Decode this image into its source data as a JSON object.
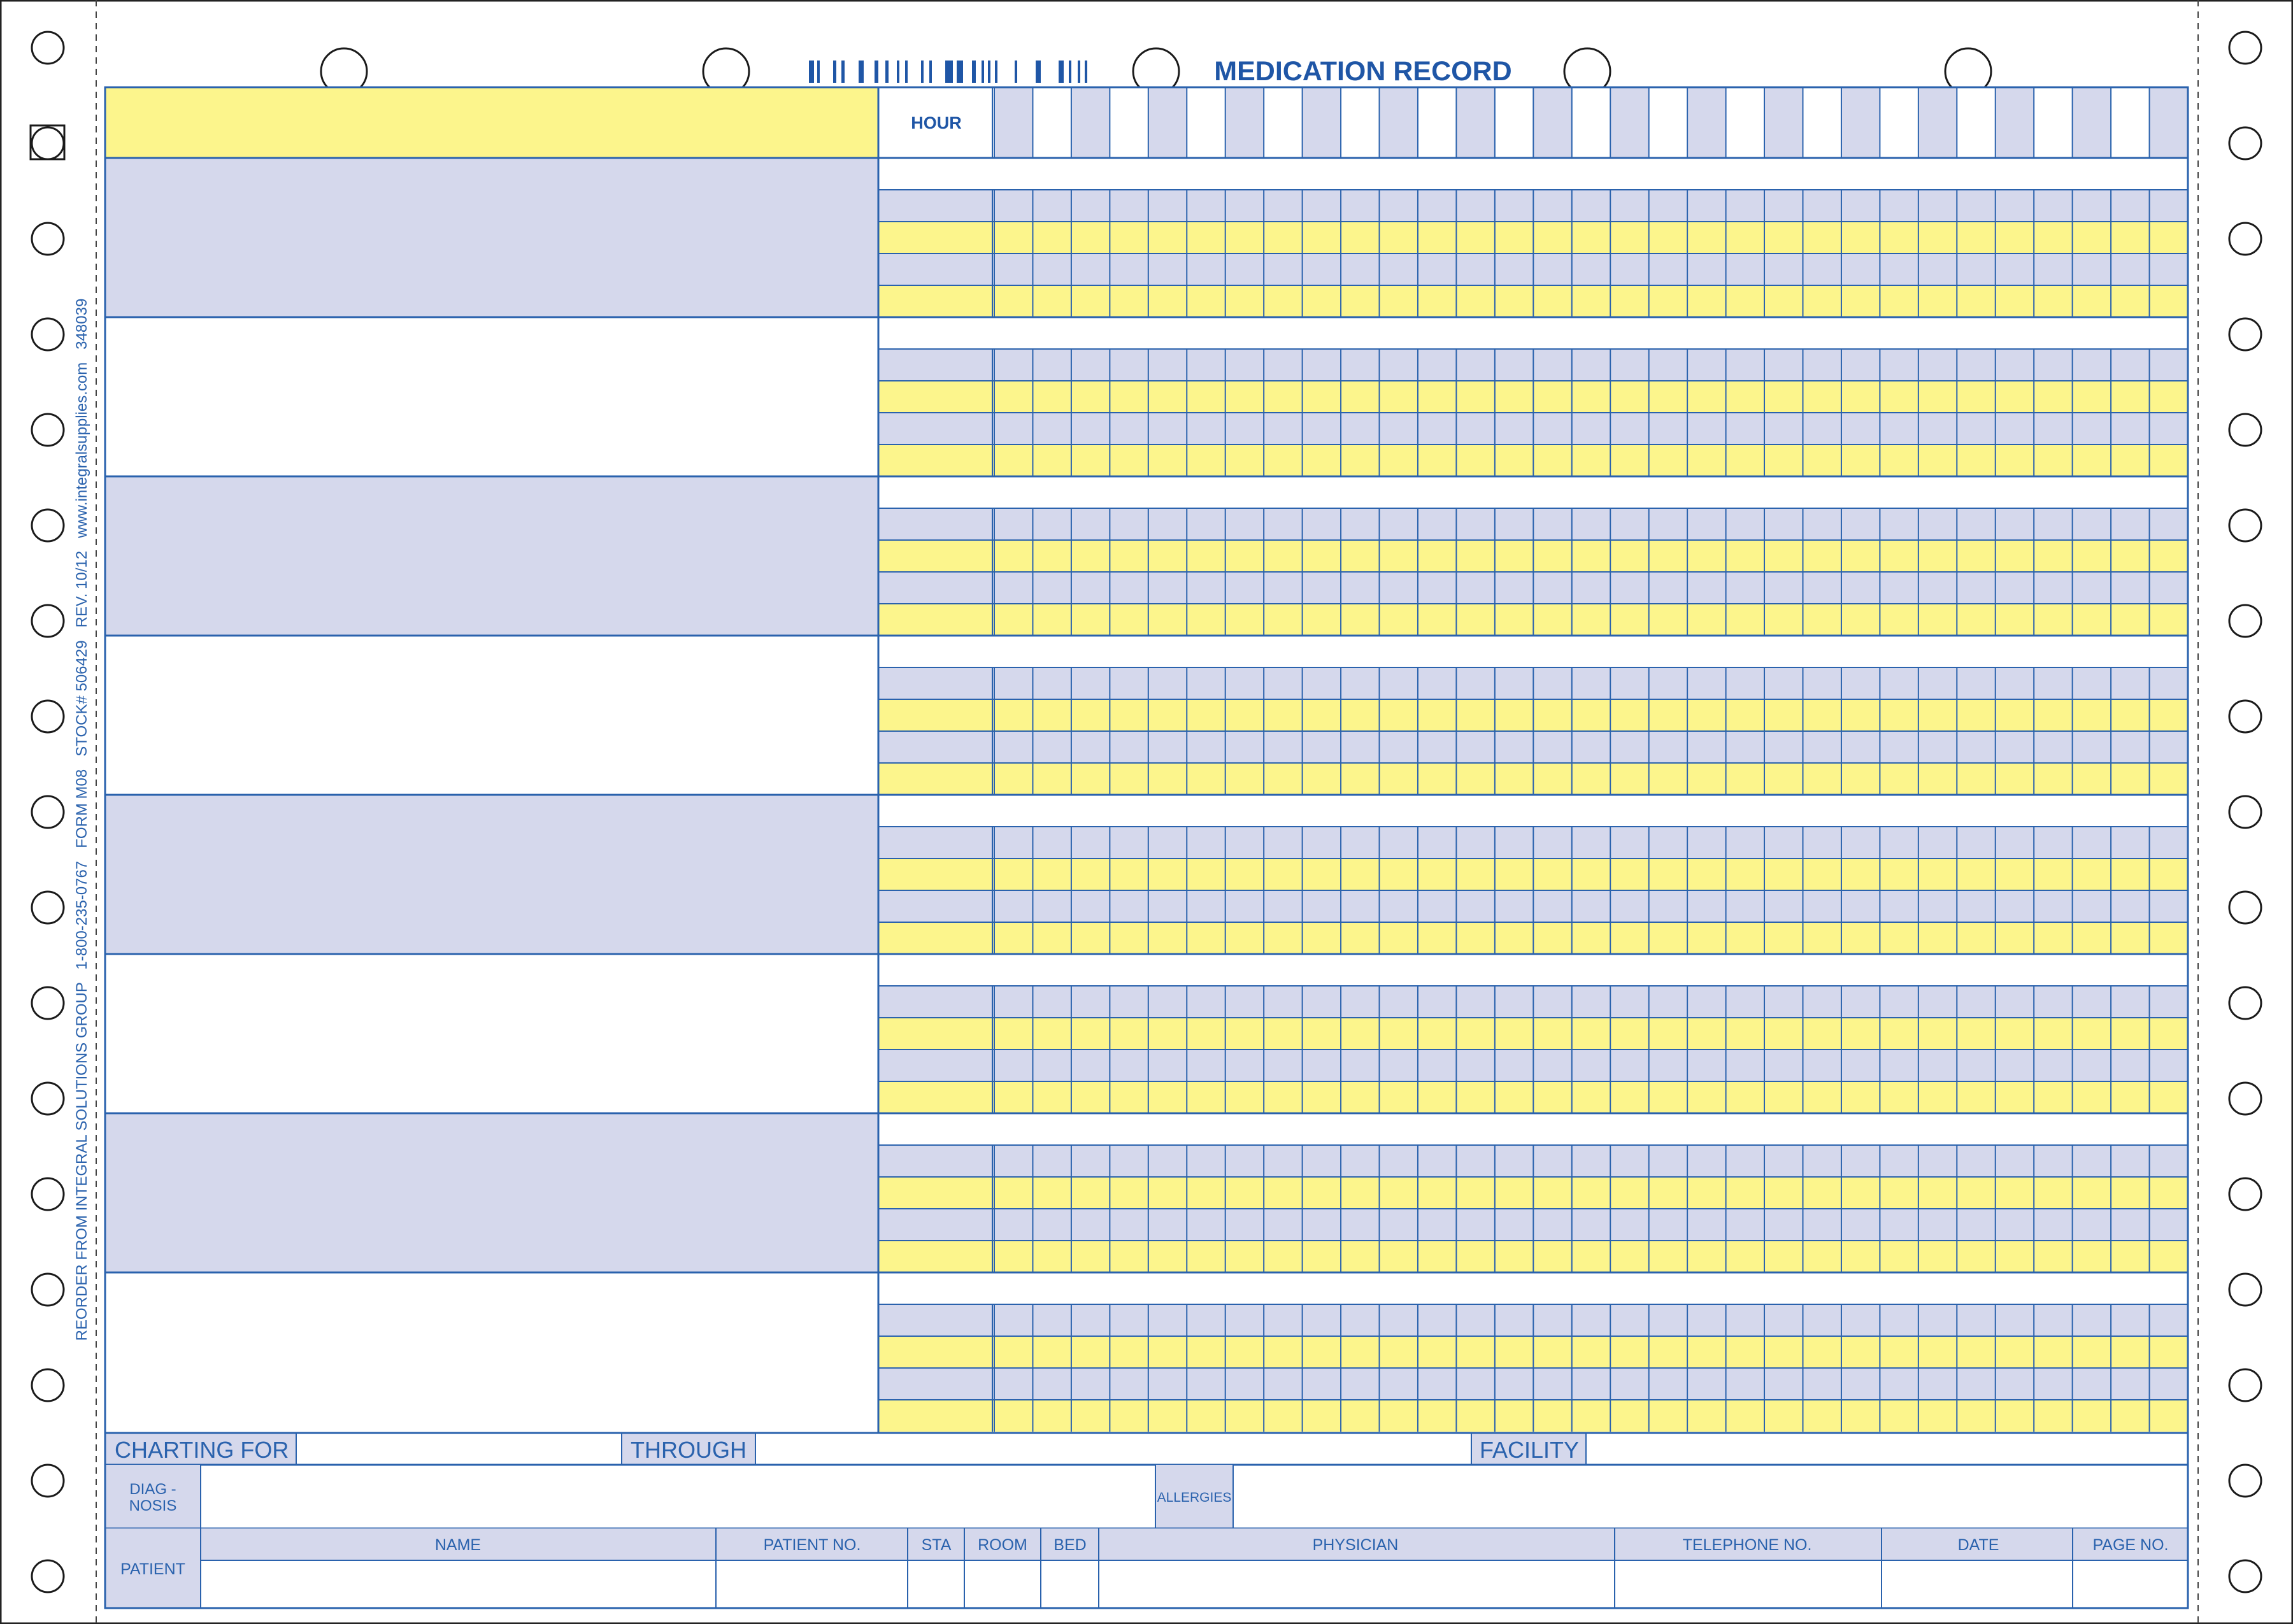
{
  "title": "MEDICATION RECORD",
  "hour_label": "HOUR",
  "side_text": "REORDER FROM INTEGRAL SOLUTIONS GROUP   1-800-235-0767   FORM M08   STOCK# 506429   REV. 10/12   www.integralsupplies.com   348039",
  "footer": {
    "charting_for": "CHARTING FOR",
    "through": "THROUGH",
    "facility": "FACILITY",
    "diagnosis_line1": "DIAG -",
    "diagnosis_line2": "NOSIS",
    "allergies": "ALLERGIES",
    "patient": "PATIENT",
    "columns": [
      "NAME",
      "PATIENT NO.",
      "STA",
      "ROOM",
      "BED",
      "PHYSICIAN",
      "TELEPHONE NO.",
      "DATE",
      "PAGE NO."
    ]
  },
  "grid": {
    "day_columns": 31,
    "medication_blocks": 8,
    "rows_per_block": 4
  },
  "colors": {
    "ink": "#2a62ad",
    "title_blue": "#1f56a6",
    "lavender": "#d5d8ec",
    "yellow": "#fcf58c",
    "hole_stroke": "#1a1a1a"
  }
}
